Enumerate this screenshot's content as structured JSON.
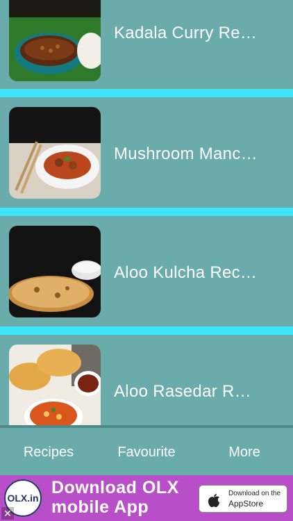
{
  "recipes": [
    {
      "title": "Kadala Curry Re…",
      "image_icon": "kadala-curry-photo"
    },
    {
      "title": "Mushroom Manc…",
      "image_icon": "mushroom-manchurian-photo"
    },
    {
      "title": "Aloo Kulcha Rec…",
      "image_icon": "aloo-kulcha-photo"
    },
    {
      "title": "Aloo Rasedar R…",
      "image_icon": "aloo-rasedar-photo"
    }
  ],
  "tabs": {
    "recipes": "Recipes",
    "favourite": "Favourite",
    "more": "More"
  },
  "ad": {
    "logo_text": "OLX.in",
    "headline": "Download OLX mobile App",
    "store_line1": "Download on the",
    "store_line2": "AppStore",
    "close_glyph": "✕"
  },
  "colors": {
    "background": "#6aacab",
    "separator": "#3fe6f7",
    "ad_background": "#b84fc9"
  }
}
